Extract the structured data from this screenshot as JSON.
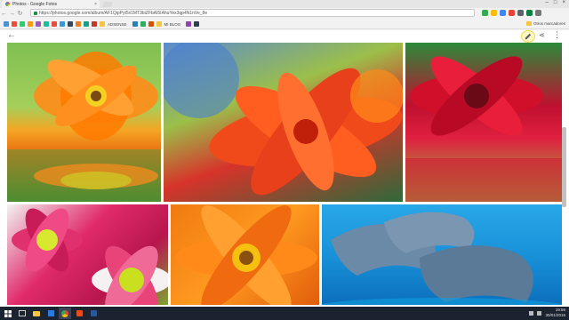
{
  "browser": {
    "tab_title": "Photos - Google Fotos",
    "tab_close": "×",
    "window_controls": [
      "–",
      "□",
      "×"
    ],
    "url": "https://photos.google.com/album/AF1QipPyt5x1MT3biZFbAI5IAhuYex3qp4N1nVe_8e",
    "nav": {
      "back": "←",
      "forward": "→",
      "reload": "↻"
    },
    "bookmarks": [
      {
        "label": "",
        "color": "#4a90d9"
      },
      {
        "label": "",
        "color": "#e84c3d"
      },
      {
        "label": "",
        "color": "#2ecc71"
      },
      {
        "label": "",
        "color": "#f39c12"
      },
      {
        "label": "",
        "color": "#9b59b6"
      },
      {
        "label": "",
        "color": "#1abc9c"
      },
      {
        "label": "",
        "color": "#e74c3c"
      },
      {
        "label": "",
        "color": "#3498db"
      },
      {
        "label": "",
        "color": "#34495e"
      },
      {
        "label": "",
        "color": "#e67e22"
      },
      {
        "label": "",
        "color": "#16a085"
      },
      {
        "label": "",
        "color": "#c0392b"
      },
      {
        "label": "ADSENSE",
        "color": "#f4c542"
      },
      {
        "label": "",
        "color": "#2980b9"
      },
      {
        "label": "",
        "color": "#27ae60"
      },
      {
        "label": "",
        "color": "#d35400"
      },
      {
        "label": "MI BLOG",
        "color": "#f4c542"
      },
      {
        "label": "",
        "color": "#8e44ad"
      },
      {
        "label": "",
        "color": "#2c3e50"
      }
    ],
    "other_bookmarks": "Otros marcadores"
  },
  "photos": {
    "back_icon": "←",
    "share_icon": "⋖",
    "more_icon": "⋮"
  },
  "taskbar": {
    "time": "19:56",
    "date": "30/01/2016"
  },
  "colors": {
    "edit_highlight": "#f0d850",
    "taskbar": "#1c2330"
  }
}
